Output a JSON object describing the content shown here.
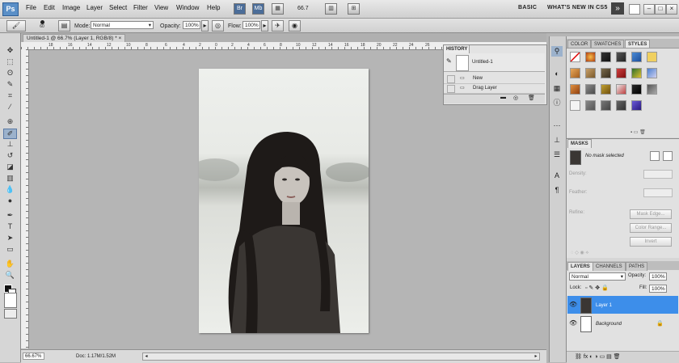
{
  "app": {
    "logo": "Ps"
  },
  "menu": [
    "File",
    "Edit",
    "Image",
    "Layer",
    "Select",
    "Filter",
    "View",
    "Window",
    "Help"
  ],
  "appbar": {
    "zoom": "66.7",
    "workspace_basic": "BASIC",
    "workspace_new": "WHAT'S NEW IN CS5",
    "more": "»"
  },
  "options": {
    "brush_size": "60",
    "mode_label": "Mode:",
    "mode_value": "Normal",
    "opacity_label": "Opacity:",
    "opacity_value": "100%",
    "flow_label": "Flow:",
    "flow_value": "100%"
  },
  "document": {
    "tab_title": "Untitled-1 @ 66.7% (Layer 1, RGB/8) *",
    "close": "×"
  },
  "ruler": {
    "top_numbers": [
      "18",
      "16",
      "14",
      "12",
      "10",
      "8",
      "6",
      "4",
      "2",
      "0",
      "2",
      "4",
      "6",
      "8",
      "10",
      "12",
      "14",
      "16",
      "18",
      "20",
      "22",
      "24",
      "26",
      "28",
      "30",
      "32",
      "34"
    ]
  },
  "status": {
    "zoom": "66.67%",
    "doc": "Doc: 1.17M/1.52M"
  },
  "history": {
    "tab": "HISTORY",
    "snapshot": "Untitled-1",
    "rows": [
      "New",
      "Drag Layer"
    ]
  },
  "styles_panel": {
    "tabs": [
      "COLOR",
      "SWATCHES",
      "STYLES"
    ]
  },
  "masks": {
    "tab": "MASKS",
    "no_mask": "No mask selected",
    "density": "Density:",
    "feather": "Feather:",
    "refine": "Refine:",
    "mask_edge": "Mask Edge...",
    "color_range": "Color Range...",
    "invert": "Invert"
  },
  "layers": {
    "tabs": [
      "LAYERS",
      "CHANNELS",
      "PATHS"
    ],
    "blend": "Normal",
    "opacity_label": "Opacity:",
    "opacity": "100%",
    "lock_label": "Lock:",
    "fill_label": "Fill:",
    "fill": "100%",
    "items": [
      {
        "name": "Layer 1"
      },
      {
        "name": "Background"
      }
    ]
  }
}
